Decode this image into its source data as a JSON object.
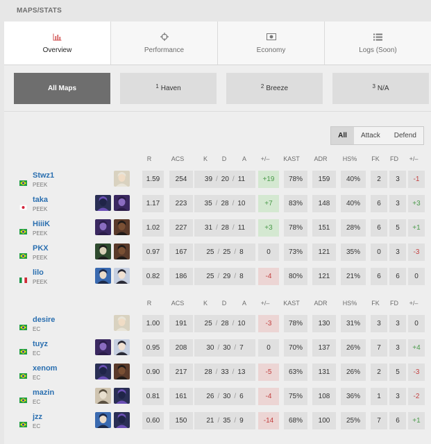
{
  "header": {
    "title": "MAPS/STATS"
  },
  "tabs": [
    {
      "label": "Overview",
      "icon": "bar-chart-icon",
      "active": true
    },
    {
      "label": "Performance",
      "icon": "crosshair-icon",
      "active": false
    },
    {
      "label": "Economy",
      "icon": "money-icon",
      "active": false
    },
    {
      "label": "Logs (Soon)",
      "icon": "list-icon",
      "active": false
    }
  ],
  "maps": [
    {
      "num": "",
      "label": "All Maps",
      "active": true
    },
    {
      "num": "1",
      "label": "Haven",
      "active": false
    },
    {
      "num": "2",
      "label": "Breeze",
      "active": false
    },
    {
      "num": "3",
      "label": "N/A",
      "active": false
    }
  ],
  "sides": [
    {
      "label": "All",
      "active": true
    },
    {
      "label": "Attack",
      "active": false
    },
    {
      "label": "Defend",
      "active": false
    }
  ],
  "columns": {
    "r": "R",
    "acs": "ACS",
    "k": "K",
    "d": "D",
    "a": "A",
    "pm": "+/–",
    "kast": "KAST",
    "adr": "ADR",
    "hs": "HS%",
    "fk": "FK",
    "fd": "FD",
    "fkd": "+/–"
  },
  "colors": {
    "positive": "#4a9a4a",
    "negative": "#c24040",
    "link": "#2a6fb0"
  },
  "teams": [
    {
      "players": [
        {
          "name": "Stwz1",
          "team": "PEEK",
          "flag": "br",
          "agents": [
            "sova"
          ],
          "r": "1.59",
          "acs": "254",
          "k": "39",
          "d": "20",
          "a": "11",
          "pm": "+19",
          "kast": "78%",
          "adr": "159",
          "hs": "40%",
          "fk": "2",
          "fd": "3",
          "fkd": "-1"
        },
        {
          "name": "taka",
          "team": "PEEK",
          "flag": "jp",
          "agents": [
            "omen",
            "reyna"
          ],
          "r": "1.17",
          "acs": "223",
          "k": "35",
          "d": "28",
          "a": "10",
          "pm": "+7",
          "kast": "83%",
          "adr": "148",
          "hs": "40%",
          "fk": "6",
          "fd": "3",
          "fkd": "+3"
        },
        {
          "name": "HiiiK",
          "team": "PEEK",
          "flag": "br",
          "agents": [
            "reyna",
            "phoenix"
          ],
          "r": "1.02",
          "acs": "227",
          "k": "31",
          "d": "28",
          "a": "11",
          "pm": "+3",
          "kast": "78%",
          "adr": "151",
          "hs": "28%",
          "fk": "6",
          "fd": "5",
          "fkd": "+1"
        },
        {
          "name": "PKX",
          "team": "PEEK",
          "flag": "br",
          "agents": [
            "viper",
            "phoenix"
          ],
          "r": "0.97",
          "acs": "167",
          "k": "25",
          "d": "25",
          "a": "8",
          "pm": "0",
          "kast": "73%",
          "adr": "121",
          "hs": "35%",
          "fk": "0",
          "fd": "3",
          "fkd": "-3"
        },
        {
          "name": "lilo",
          "team": "PEEK",
          "flag": "it",
          "agents": [
            "jett",
            "sage"
          ],
          "r": "0.82",
          "acs": "186",
          "k": "25",
          "d": "29",
          "a": "8",
          "pm": "-4",
          "kast": "80%",
          "adr": "121",
          "hs": "21%",
          "fk": "6",
          "fd": "6",
          "fkd": "0"
        }
      ]
    },
    {
      "players": [
        {
          "name": "desire",
          "team": "EC",
          "flag": "br",
          "agents": [
            "sova"
          ],
          "r": "1.00",
          "acs": "191",
          "k": "25",
          "d": "28",
          "a": "10",
          "pm": "-3",
          "kast": "78%",
          "adr": "130",
          "hs": "31%",
          "fk": "3",
          "fd": "3",
          "fkd": "0"
        },
        {
          "name": "tuyz",
          "team": "EC",
          "flag": "br",
          "agents": [
            "reyna",
            "sage"
          ],
          "r": "0.95",
          "acs": "208",
          "k": "30",
          "d": "30",
          "a": "7",
          "pm": "0",
          "kast": "70%",
          "adr": "137",
          "hs": "26%",
          "fk": "7",
          "fd": "3",
          "fkd": "+4"
        },
        {
          "name": "xenom",
          "team": "EC",
          "flag": "br",
          "agents": [
            "omen",
            "phoenix"
          ],
          "r": "0.90",
          "acs": "217",
          "k": "28",
          "d": "33",
          "a": "13",
          "pm": "-5",
          "kast": "63%",
          "adr": "131",
          "hs": "26%",
          "fk": "2",
          "fd": "5",
          "fkd": "-3"
        },
        {
          "name": "mazin",
          "team": "EC",
          "flag": "br",
          "agents": [
            "cypher",
            "omen"
          ],
          "r": "0.81",
          "acs": "161",
          "k": "26",
          "d": "30",
          "a": "6",
          "pm": "-4",
          "kast": "75%",
          "adr": "108",
          "hs": "36%",
          "fk": "1",
          "fd": "3",
          "fkd": "-2"
        },
        {
          "name": "jzz",
          "team": "EC",
          "flag": "br",
          "agents": [
            "jett",
            "omen"
          ],
          "r": "0.60",
          "acs": "150",
          "k": "21",
          "d": "35",
          "a": "9",
          "pm": "-14",
          "kast": "68%",
          "adr": "100",
          "hs": "25%",
          "fk": "7",
          "fd": "6",
          "fkd": "+1"
        }
      ]
    }
  ]
}
